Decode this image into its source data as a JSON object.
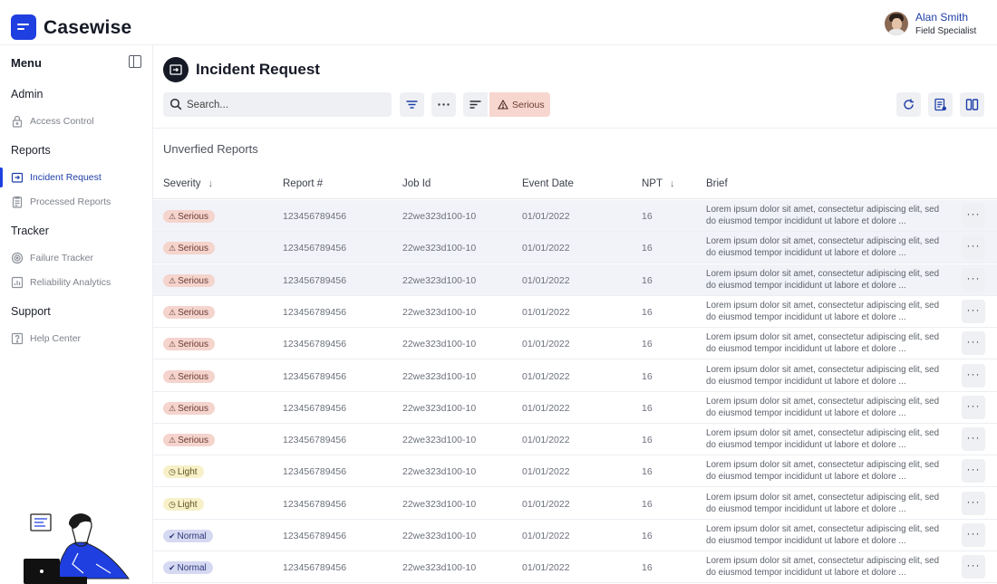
{
  "app": {
    "name": "Casewise"
  },
  "user": {
    "name": "Alan Smith",
    "role": "Field Specialist"
  },
  "sidebar": {
    "menu_title": "Menu",
    "sections": [
      {
        "title": "Admin",
        "items": [
          {
            "label": "Access Control",
            "icon": "lock-icon"
          }
        ]
      },
      {
        "title": "Reports",
        "items": [
          {
            "label": "Incident Request",
            "icon": "incident-icon",
            "active": true
          },
          {
            "label": "Processed Reports",
            "icon": "clipboard-icon"
          }
        ]
      },
      {
        "title": "Tracker",
        "items": [
          {
            "label": "Failure Tracker",
            "icon": "target-icon"
          },
          {
            "label": "Reliability Analytics",
            "icon": "chart-icon"
          }
        ]
      },
      {
        "title": "Support",
        "items": [
          {
            "label": "Help Center",
            "icon": "help-icon"
          }
        ]
      }
    ]
  },
  "main": {
    "title": "Incident Request",
    "search": {
      "placeholder": "Search..."
    },
    "filter_chip": "Serious",
    "section_title": "Unverfied Reports"
  },
  "table": {
    "headers": {
      "severity": "Severity",
      "report": "Report #",
      "job": "Job Id",
      "date": "Event Date",
      "npt": "NPT",
      "brief": "Brief"
    },
    "rows": [
      {
        "severity": "Serious",
        "level": "serious",
        "report": "123456789456",
        "job": "22we323d100-10",
        "date": "01/01/2022",
        "npt": "16",
        "brief": "Lorem ipsum dolor sit amet, consectetur adipiscing elit, sed do eiusmod tempor incididunt ut labore et dolore ..."
      },
      {
        "severity": "Serious",
        "level": "serious",
        "report": "123456789456",
        "job": "22we323d100-10",
        "date": "01/01/2022",
        "npt": "16",
        "brief": "Lorem ipsum dolor sit amet, consectetur adipiscing elit, sed do eiusmod tempor incididunt ut labore et dolore ..."
      },
      {
        "severity": "Serious",
        "level": "serious",
        "report": "123456789456",
        "job": "22we323d100-10",
        "date": "01/01/2022",
        "npt": "16",
        "brief": "Lorem ipsum dolor sit amet, consectetur adipiscing elit, sed do eiusmod tempor incididunt ut labore et dolore ..."
      },
      {
        "severity": "Serious",
        "level": "serious",
        "report": "123456789456",
        "job": "22we323d100-10",
        "date": "01/01/2022",
        "npt": "16",
        "brief": "Lorem ipsum dolor sit amet, consectetur adipiscing elit, sed do eiusmod tempor incididunt ut labore et dolore ..."
      },
      {
        "severity": "Serious",
        "level": "serious",
        "report": "123456789456",
        "job": "22we323d100-10",
        "date": "01/01/2022",
        "npt": "16",
        "brief": "Lorem ipsum dolor sit amet, consectetur adipiscing elit, sed do eiusmod tempor incididunt ut labore et dolore ..."
      },
      {
        "severity": "Serious",
        "level": "serious",
        "report": "123456789456",
        "job": "22we323d100-10",
        "date": "01/01/2022",
        "npt": "16",
        "brief": "Lorem ipsum dolor sit amet, consectetur adipiscing elit, sed do eiusmod tempor incididunt ut labore et dolore ..."
      },
      {
        "severity": "Serious",
        "level": "serious",
        "report": "123456789456",
        "job": "22we323d100-10",
        "date": "01/01/2022",
        "npt": "16",
        "brief": "Lorem ipsum dolor sit amet, consectetur adipiscing elit, sed do eiusmod tempor incididunt ut labore et dolore ..."
      },
      {
        "severity": "Serious",
        "level": "serious",
        "report": "123456789456",
        "job": "22we323d100-10",
        "date": "01/01/2022",
        "npt": "16",
        "brief": "Lorem ipsum dolor sit amet, consectetur adipiscing elit, sed do eiusmod tempor incididunt ut labore et dolore ..."
      },
      {
        "severity": "Light",
        "level": "light",
        "report": "123456789456",
        "job": "22we323d100-10",
        "date": "01/01/2022",
        "npt": "16",
        "brief": "Lorem ipsum dolor sit amet, consectetur adipiscing elit, sed do eiusmod tempor incididunt ut labore et dolore ..."
      },
      {
        "severity": "Light",
        "level": "light",
        "report": "123456789456",
        "job": "22we323d100-10",
        "date": "01/01/2022",
        "npt": "16",
        "brief": "Lorem ipsum dolor sit amet, consectetur adipiscing elit, sed do eiusmod tempor incididunt ut labore et dolore ..."
      },
      {
        "severity": "Normal",
        "level": "normal",
        "report": "123456789456",
        "job": "22we323d100-10",
        "date": "01/01/2022",
        "npt": "16",
        "brief": "Lorem ipsum dolor sit amet, consectetur adipiscing elit, sed do eiusmod tempor incididunt ut labore et dolore ..."
      },
      {
        "severity": "Normal",
        "level": "normal",
        "report": "123456789456",
        "job": "22we323d100-10",
        "date": "01/01/2022",
        "npt": "16",
        "brief": "Lorem ipsum dolor sit amet, consectetur adipiscing elit, sed do eiusmod tempor incididunt ut labore et dolore ..."
      }
    ]
  },
  "colors": {
    "accent": "#1f3fe0",
    "serious_bg": "#f4d4cd",
    "light_bg": "#f8f0c8",
    "normal_bg": "#d6d9f2"
  }
}
